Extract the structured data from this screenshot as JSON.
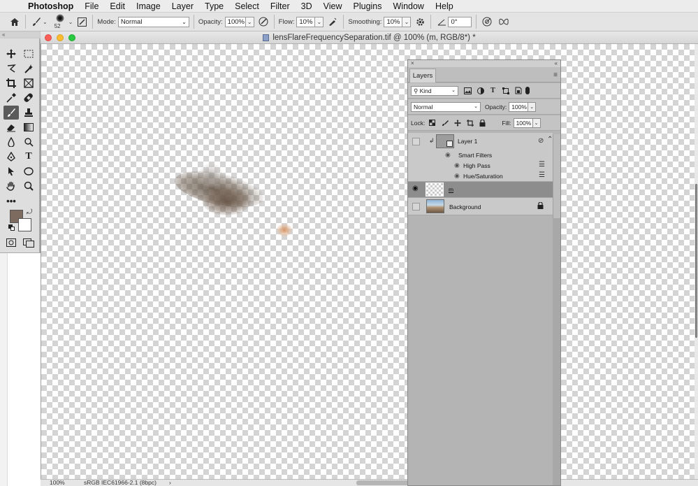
{
  "menubar": {
    "app_name": "Photoshop",
    "items": [
      "File",
      "Edit",
      "Image",
      "Layer",
      "Type",
      "Select",
      "Filter",
      "3D",
      "View",
      "Plugins",
      "Window",
      "Help"
    ]
  },
  "options_bar": {
    "brush_size": "52",
    "mode_label": "Mode:",
    "mode_value": "Normal",
    "opacity_label": "Opacity:",
    "opacity_value": "100%",
    "flow_label": "Flow:",
    "flow_value": "10%",
    "smoothing_label": "Smoothing:",
    "smoothing_value": "10%",
    "angle_value": "0°"
  },
  "tools_panel": {
    "collapse_label": "«"
  },
  "document": {
    "title": "lensFlareFrequencySeparation.tif @ 100% (m, RGB/8*) *",
    "zoom": "100%",
    "profile": "sRGB IEC61966-2.1 (8bpc)",
    "status_arrow": "›"
  },
  "layers_panel": {
    "close_label": "×",
    "collapse_label": "«",
    "tab_label": "Layers",
    "filter_kind": "Kind",
    "blend_mode": "Normal",
    "opacity_label": "Opacity:",
    "opacity_value": "100%",
    "lock_label": "Lock:",
    "fill_label": "Fill:",
    "fill_value": "100%",
    "layers": [
      {
        "name": "Layer 1",
        "visible": false
      },
      {
        "name": "Smart Filters"
      },
      {
        "name": "High Pass"
      },
      {
        "name": "Hue/Saturation"
      },
      {
        "name": "m",
        "visible": true,
        "selected": true
      },
      {
        "name": "Background",
        "visible": false,
        "locked": true
      }
    ]
  },
  "colors": {
    "foreground": "#7d6b60",
    "background": "#ffffff",
    "selected_layer": "#8d8d8d"
  }
}
